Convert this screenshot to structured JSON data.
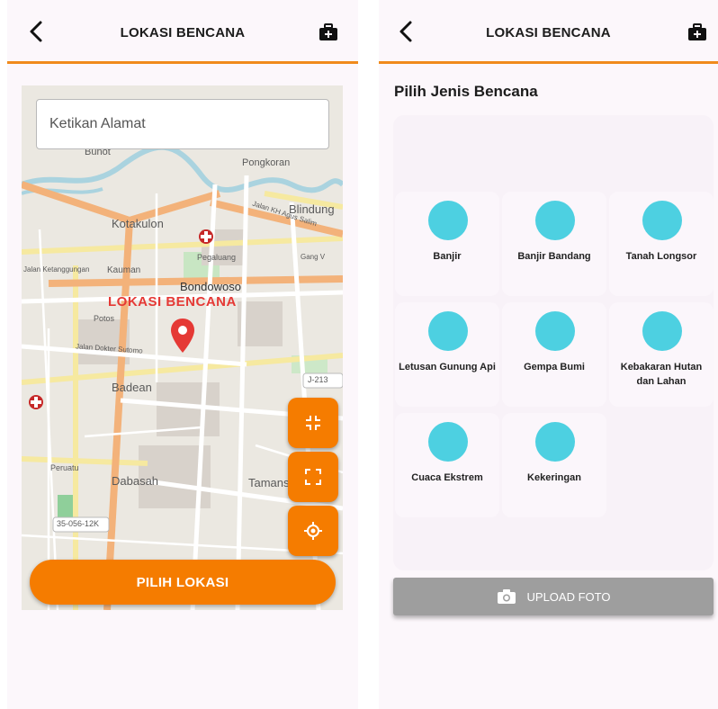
{
  "left_screen": {
    "appbar": {
      "title": "LOKASI BENCANA"
    },
    "map": {
      "search_placeholder": "Ketikan Alamat",
      "labels": {
        "pongkoran": "Pongkoran",
        "bunot": "Bunot",
        "blindung": "Blindung",
        "kotakulon": "Kotakulon",
        "jalan_kh": "Jalan KH Agus Salim",
        "pegaluang": "Pegaluang",
        "gang": "Gang V",
        "jalan_ketanggungan": "Jalan Ketanggungan",
        "kauman": "Kauman",
        "bondowoso": "Bondowoso",
        "potos": "Potos",
        "jalan_dokter": "Jalan Dokter Sutomo",
        "badean": "Badean",
        "dabasah": "Dabasah",
        "tamansari": "Tamansari",
        "peruatu": "Peruatu",
        "road_code": "35-056-12K",
        "j213": "J-213"
      },
      "disaster_label": "LOKASI BENCANA"
    },
    "pick_button": "PILIH LOKASI"
  },
  "right_screen": {
    "appbar": {
      "title": "LOKASI BENCANA"
    },
    "section_title": "Pilih Jenis Bencana",
    "disasters": [
      {
        "label": "Banjir"
      },
      {
        "label": "Banjir Bandang"
      },
      {
        "label": "Tanah Longsor"
      },
      {
        "label": "Letusan Gunung Api"
      },
      {
        "label": "Gempa Bumi"
      },
      {
        "label": "Kebakaran Hutan dan Lahan"
      },
      {
        "label": "Cuaca Ekstrem"
      },
      {
        "label": "Kekeringan"
      }
    ],
    "upload_button": "UPLOAD FOTO"
  },
  "colors": {
    "accent": "#f57c00",
    "disaster_red": "#e53935",
    "icon_cyan": "#4dd0e1",
    "upload_gray": "#9e9e9e"
  },
  "icons": [
    "back-arrow-icon",
    "first-aid-kit-icon",
    "map-pin-icon",
    "fullscreen-exit-icon",
    "fullscreen-icon",
    "my-location-icon",
    "camera-icon"
  ]
}
